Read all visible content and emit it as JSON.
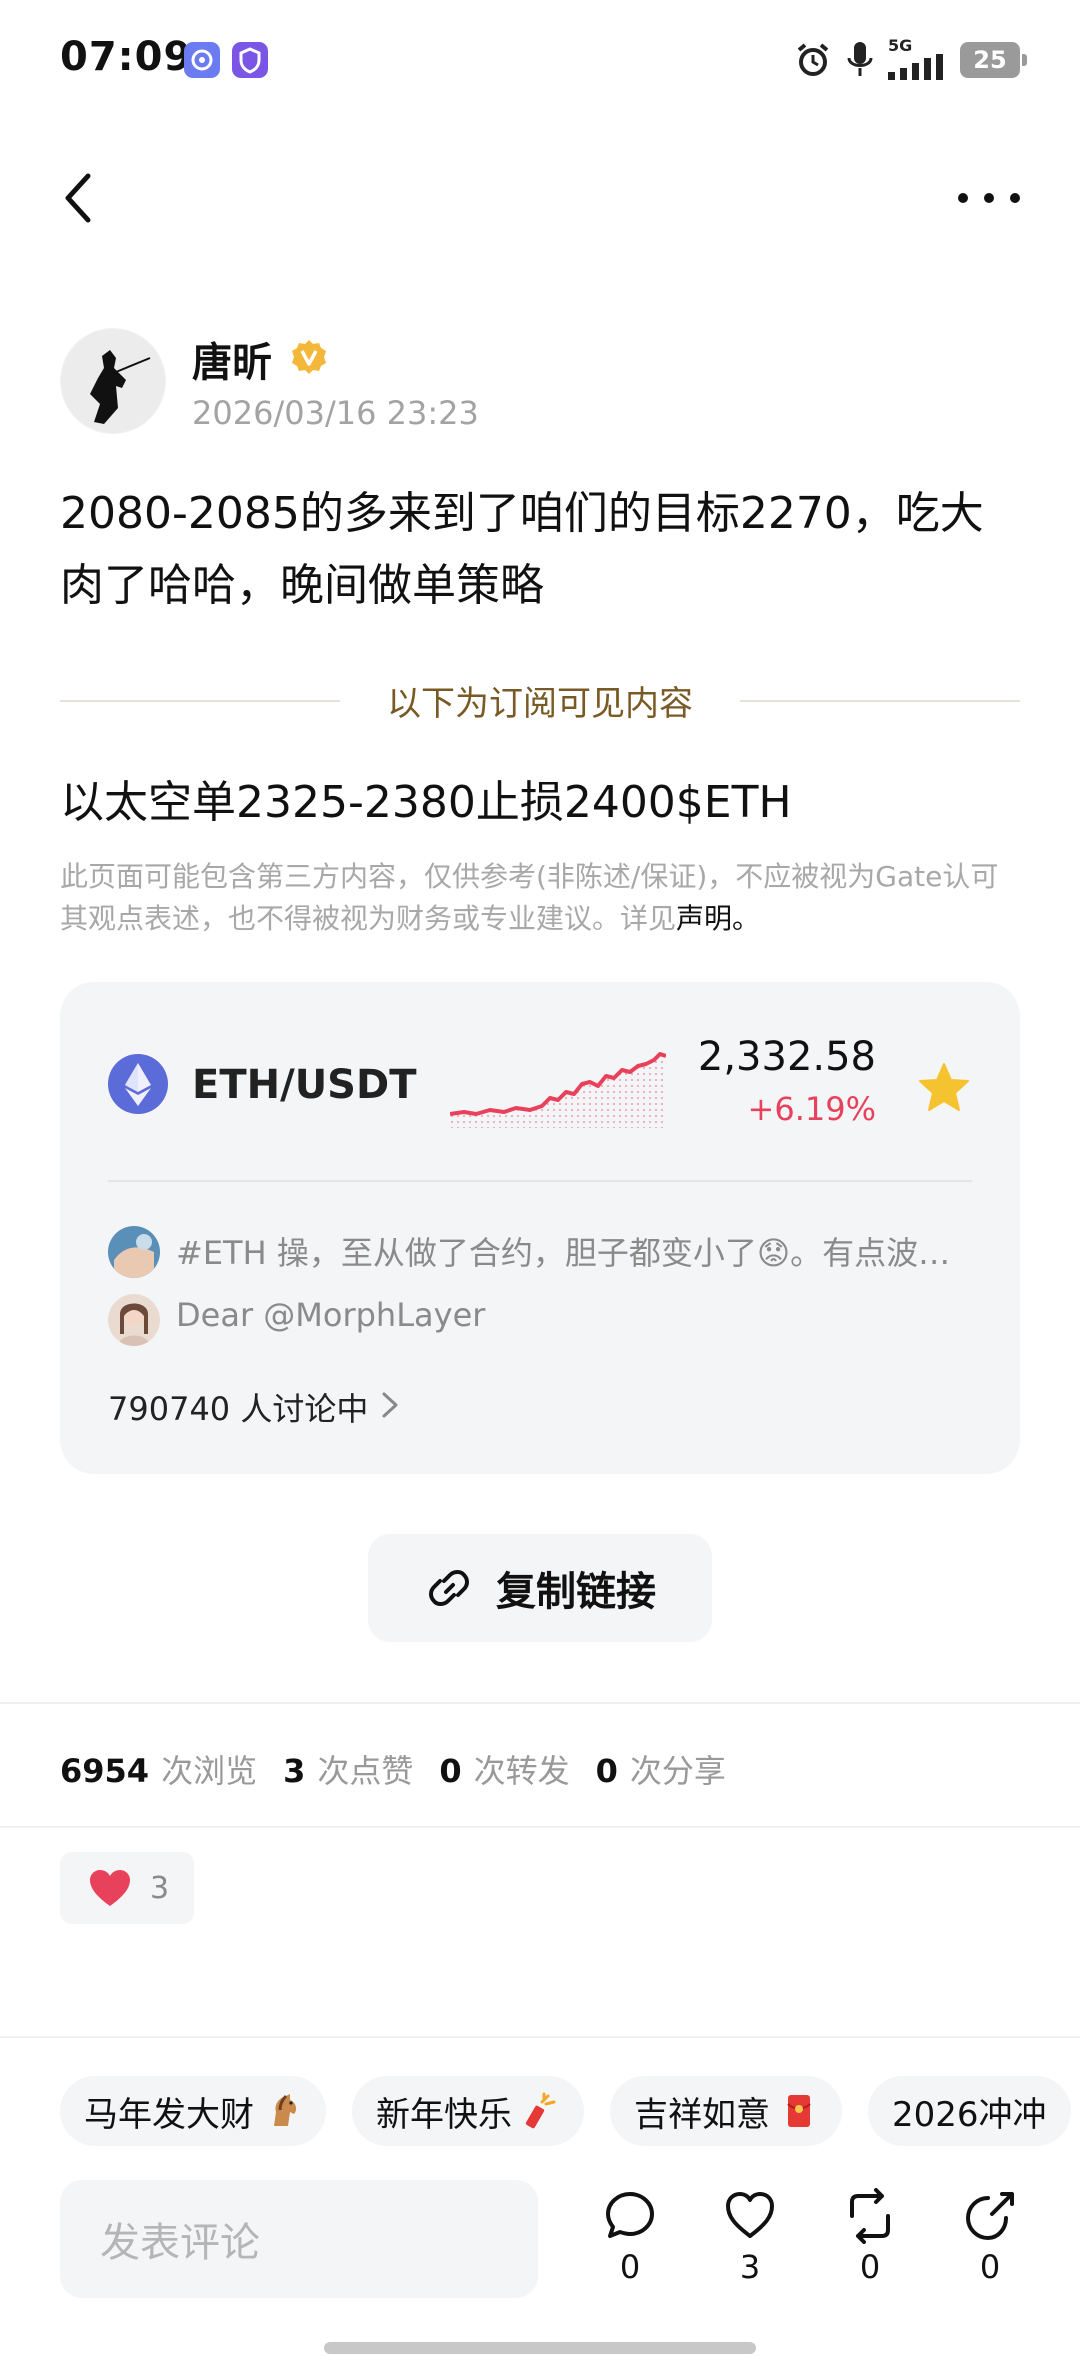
{
  "status_bar": {
    "time": "07:09",
    "network": "5G",
    "battery": "25"
  },
  "nav": {
    "back_icon": "chevron-left-icon",
    "more_icon": "more-horizontal-icon"
  },
  "post": {
    "author": "唐昕",
    "verified_icon": "verified-badge-icon",
    "date": "2026/03/16 23:23",
    "body": "2080-2085的多来到了咱们的目标2270，吃大肉了哈哈，晚间做单策略",
    "subscription_divider": "以下为订阅可见内容",
    "subscribed_text": "以太空单2325-2380止损2400$ETH",
    "disclaimer": "此页面可能包含第三方内容，仅供参考(非陈述/保证)，不应被视为Gate认可其观点表述，也不得被视为财务或专业建议。详见",
    "disclaimer_link": "声明。"
  },
  "market_card": {
    "pair": "ETH/USDT",
    "price": "2,332.58",
    "change": "+6.19%",
    "change_color": "#e8415c",
    "star_color": "#f5c330",
    "feed": [
      {
        "text": "#ETH 操，至从做了合约，胆子都变小了😟。有点波…"
      },
      {
        "text": "Dear @MorphLayer"
      }
    ],
    "discussion": "790740 人讨论中"
  },
  "copy_link": {
    "label": "复制链接",
    "icon": "link-icon"
  },
  "stats": [
    {
      "num": "6954",
      "label": "次浏览"
    },
    {
      "num": "3",
      "label": "次点赞"
    },
    {
      "num": "0",
      "label": "次转发"
    },
    {
      "num": "0",
      "label": "次分享"
    }
  ],
  "reaction": {
    "icon": "heart-icon",
    "count": "3"
  },
  "quick_chips": [
    {
      "label": "马年发大财",
      "icon": "horse-emoji"
    },
    {
      "label": "新年快乐",
      "icon": "firecracker-emoji"
    },
    {
      "label": "吉祥如意",
      "icon": "red-envelope-emoji"
    },
    {
      "label": "2026冲冲",
      "icon": ""
    }
  ],
  "comment": {
    "placeholder": "发表评论"
  },
  "actions": [
    {
      "name": "comment",
      "icon": "comment-icon",
      "count": "0"
    },
    {
      "name": "like",
      "icon": "heart-outline-icon",
      "count": "3"
    },
    {
      "name": "repost",
      "icon": "repost-icon",
      "count": "0"
    },
    {
      "name": "share",
      "icon": "share-icon",
      "count": "0"
    }
  ]
}
